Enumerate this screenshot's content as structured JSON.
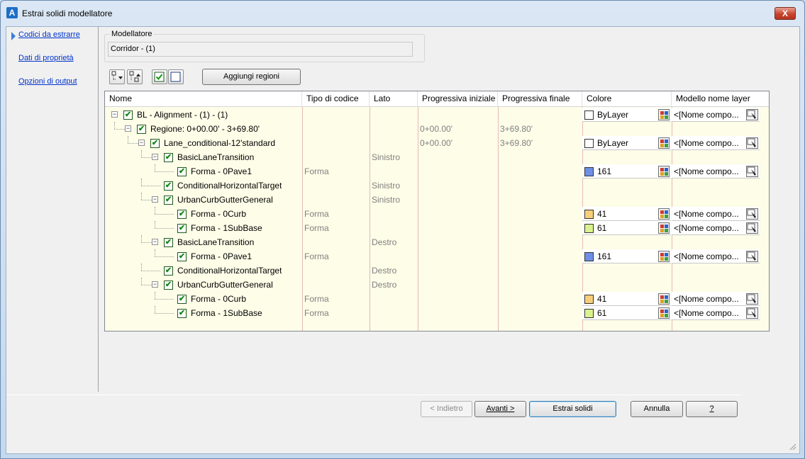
{
  "window": {
    "title": "Estrai solidi modellatore",
    "close_label": "X",
    "app_icon_letter": "A"
  },
  "nav": [
    {
      "label": "Codici da estrarre",
      "active": true
    },
    {
      "label": "Dati di proprietà",
      "active": false
    },
    {
      "label": "Opzioni di output",
      "active": false
    }
  ],
  "modeler": {
    "group_label": "Modellatore",
    "value": "Corridor - (1)"
  },
  "toolbar": {
    "add_regions_label": "Aggiungi regioni",
    "check_all": "✔"
  },
  "grid": {
    "columns": [
      "Nome",
      "Tipo di codice",
      "Lato",
      "Progressiva iniziale",
      "Progressiva finale",
      "Colore",
      "Modello nome layer"
    ],
    "rows": [
      {
        "level": 0,
        "toggle": "−",
        "name": "BL - Alignment - (1) - (1)",
        "type": "",
        "side": "",
        "start": "",
        "end": "",
        "color": "ByLayer",
        "swatch": "#ffffff",
        "layer": "<[Nome compo..."
      },
      {
        "level": 1,
        "toggle": "−",
        "name": "Regione: 0+00.00' - 3+69.80'",
        "type": "",
        "side": "",
        "start": "0+00.00'",
        "end": "3+69.80'",
        "color": "",
        "swatch": "",
        "layer": ""
      },
      {
        "level": 2,
        "toggle": "−",
        "name": "Lane_conditional-12'standard",
        "type": "",
        "side": "",
        "start": "0+00.00'",
        "end": "3+69.80'",
        "color": "ByLayer",
        "swatch": "#ffffff",
        "layer": "<[Nome compo..."
      },
      {
        "level": 3,
        "toggle": "−",
        "name": "BasicLaneTransition",
        "type": "",
        "side": "Sinistro",
        "start": "",
        "end": "",
        "color": "",
        "swatch": "",
        "layer": ""
      },
      {
        "level": 4,
        "toggle": "",
        "name": "Forma - 0Pave1",
        "type": "Forma",
        "side": "",
        "start": "",
        "end": "",
        "color": "161",
        "swatch": "#6f8fe6",
        "layer": "<[Nome compo..."
      },
      {
        "level": 3,
        "toggle": "",
        "name": "ConditionalHorizontalTarget",
        "type": "",
        "side": "Sinistro",
        "start": "",
        "end": "",
        "color": "",
        "swatch": "",
        "layer": ""
      },
      {
        "level": 3,
        "toggle": "−",
        "name": "UrbanCurbGutterGeneral",
        "type": "",
        "side": "Sinistro",
        "start": "",
        "end": "",
        "color": "",
        "swatch": "",
        "layer": ""
      },
      {
        "level": 4,
        "toggle": "",
        "name": "Forma - 0Curb",
        "type": "Forma",
        "side": "",
        "start": "",
        "end": "",
        "color": "41",
        "swatch": "#f7cf7a",
        "layer": "<[Nome compo..."
      },
      {
        "level": 4,
        "toggle": "",
        "name": "Forma - 1SubBase",
        "type": "Forma",
        "side": "",
        "start": "",
        "end": "",
        "color": "61",
        "swatch": "#d9f28e",
        "layer": "<[Nome compo..."
      },
      {
        "level": 3,
        "toggle": "−",
        "name": "BasicLaneTransition",
        "type": "",
        "side": "Destro",
        "start": "",
        "end": "",
        "color": "",
        "swatch": "",
        "layer": ""
      },
      {
        "level": 4,
        "toggle": "",
        "name": "Forma - 0Pave1",
        "type": "Forma",
        "side": "",
        "start": "",
        "end": "",
        "color": "161",
        "swatch": "#6f8fe6",
        "layer": "<[Nome compo..."
      },
      {
        "level": 3,
        "toggle": "",
        "name": "ConditionalHorizontalTarget",
        "type": "",
        "side": "Destro",
        "start": "",
        "end": "",
        "color": "",
        "swatch": "",
        "layer": ""
      },
      {
        "level": 3,
        "toggle": "−",
        "name": "UrbanCurbGutterGeneral",
        "type": "",
        "side": "Destro",
        "start": "",
        "end": "",
        "color": "",
        "swatch": "",
        "layer": ""
      },
      {
        "level": 4,
        "toggle": "",
        "name": "Forma - 0Curb",
        "type": "Forma",
        "side": "",
        "start": "",
        "end": "",
        "color": "41",
        "swatch": "#f7cf7a",
        "layer": "<[Nome compo..."
      },
      {
        "level": 4,
        "toggle": "",
        "name": "Forma - 1SubBase",
        "type": "Forma",
        "side": "",
        "start": "",
        "end": "",
        "color": "61",
        "swatch": "#d9f28e",
        "layer": "<[Nome compo..."
      }
    ]
  },
  "footer": {
    "back": "< Indietro",
    "next": "Avanti >",
    "extract": "Estrai solidi",
    "cancel": "Annulla",
    "help": "?"
  }
}
